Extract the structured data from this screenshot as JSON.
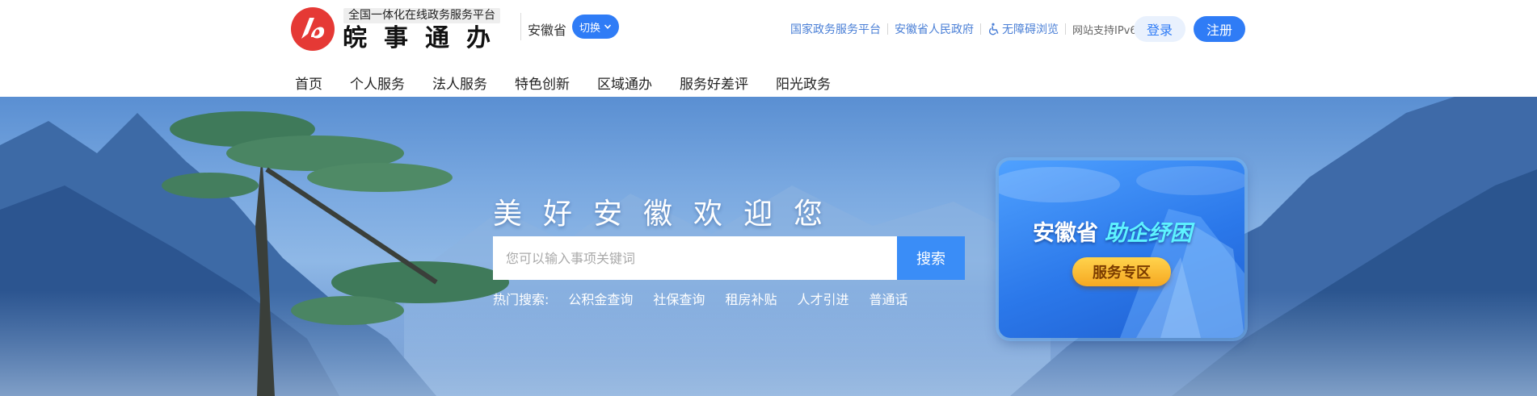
{
  "header": {
    "platform_tag": "全国一体化在线政务服务平台",
    "site_name": "皖事通办",
    "province": "安徽省",
    "switch_label": "切换",
    "links": {
      "national": "国家政务服务平台",
      "provincial": "安徽省人民政府",
      "accessibility": "无障碍浏览",
      "ipv6": "网站支持IPv6"
    },
    "login": "登录",
    "register": "注册"
  },
  "nav": {
    "home": "首页",
    "personal": "个人服务",
    "corporate": "法人服务",
    "innovation": "特色创新",
    "regional": "区域通办",
    "rating": "服务好差评",
    "sunshine": "阳光政务"
  },
  "banner": {
    "welcome": "美好安徽欢迎您",
    "search_placeholder": "您可以输入事项关键词",
    "search_button": "搜索",
    "hot_label": "热门搜索:",
    "hot": [
      "公积金查询",
      "社保查询",
      "租房补贴",
      "人才引进",
      "普通话"
    ]
  },
  "promo": {
    "title_main": "安徽省",
    "title_highlight": "助企纾困",
    "button": "服务专区"
  },
  "colors": {
    "brand_red": "#e53935",
    "primary_blue": "#2f7cf6"
  }
}
